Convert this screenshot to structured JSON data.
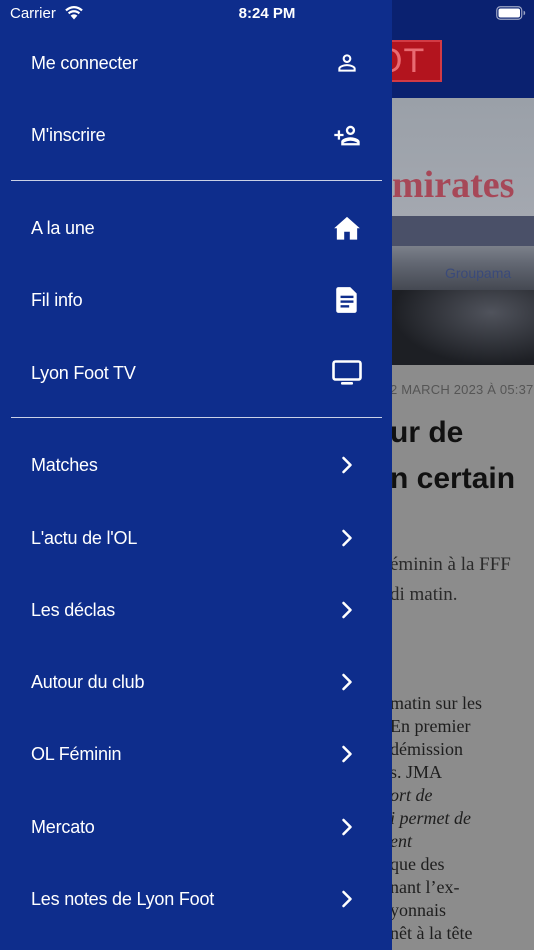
{
  "status_bar": {
    "carrier": "Carrier",
    "time": "8:24 PM"
  },
  "menu": {
    "account": [
      {
        "label": "Me connecter",
        "icon": "user-icon"
      },
      {
        "label": "M'inscrire",
        "icon": "add-user-icon"
      }
    ],
    "sections": [
      {
        "label": "A la une",
        "icon": "home-icon"
      },
      {
        "label": "Fil info",
        "icon": "article-icon"
      },
      {
        "label": "Lyon Foot TV",
        "icon": "tv-icon"
      }
    ],
    "categories": [
      {
        "label": "Matches",
        "icon": "chevron-right-icon"
      },
      {
        "label": "L'actu de l'OL",
        "icon": "chevron-right-icon"
      },
      {
        "label": "Les déclas",
        "icon": "chevron-right-icon"
      },
      {
        "label": "Autour du club",
        "icon": "chevron-right-icon"
      },
      {
        "label": "OL Féminin",
        "icon": "chevron-right-icon"
      },
      {
        "label": "Mercato",
        "icon": "chevron-right-icon"
      },
      {
        "label": "Les notes de Lyon Foot",
        "icon": "chevron-right-icon"
      }
    ]
  },
  "background_article": {
    "logo_text": "OT",
    "photo_sponsor": "mirates",
    "photo_sponsor_2": "Groupama",
    "date": "2 MARCH 2023 À 05:37",
    "title_lines": "ur de\nn certain",
    "lead_lines": "éminin à la FFF\ndi matin.",
    "body_line_1": "matin sur les",
    "body_line_2": "En premier",
    "body_line_3": "démission",
    "body_line_4": "s. JMA",
    "body_line_5": "ort de",
    "body_line_6": "i permet de",
    "body_line_7": "ent",
    "body_line_8": "que des",
    "body_line_9": "nant l’ex-",
    "body_line_10": "yonnais",
    "body_line_11": "nêt à la tête"
  },
  "colors": {
    "drawer_background": "#0e2d8c",
    "divider": "#c9d0e6",
    "text": "#ffffff"
  }
}
